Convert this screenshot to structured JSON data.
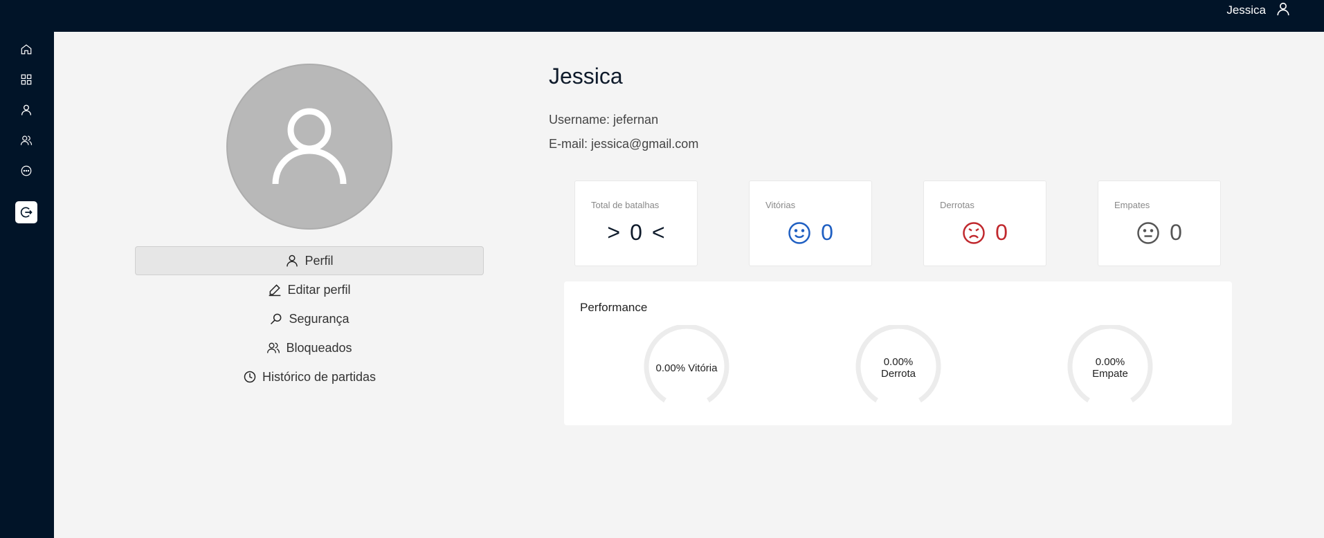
{
  "topbar": {
    "username": "Jessica",
    "user_icon": "user-icon"
  },
  "sidebar": {
    "items": [
      {
        "icon": "home-icon"
      },
      {
        "icon": "grid-icon"
      },
      {
        "icon": "user-icon"
      },
      {
        "icon": "users-icon"
      },
      {
        "icon": "chat-icon"
      }
    ],
    "logo_icon": "logout-icon"
  },
  "profile": {
    "name": "Jessica",
    "username_label": "Username: jefernan",
    "email_label": "E-mail: jessica@gmail.com"
  },
  "menu": {
    "items": [
      {
        "label": "Perfil",
        "icon": "user-icon",
        "active": true
      },
      {
        "label": "Editar perfil",
        "icon": "pencil-icon"
      },
      {
        "label": "Segurança",
        "icon": "search-icon"
      },
      {
        "label": "Bloqueados",
        "icon": "users-icon"
      },
      {
        "label": "Histórico de partidas",
        "icon": "clock-icon"
      }
    ]
  },
  "stats": [
    {
      "label": "Total de batalhas",
      "value": "0",
      "prefix": ">",
      "suffix": "<",
      "color": "#0f1b2b"
    },
    {
      "label": "Vitórias",
      "value": "0",
      "icon": "smile-icon",
      "color": "#1f5fc2"
    },
    {
      "label": "Derrotas",
      "value": "0",
      "icon": "frown-icon",
      "color": "#c0282d"
    },
    {
      "label": "Empates",
      "value": "0",
      "icon": "neutral-face-icon",
      "color": "#555555"
    }
  ],
  "performance": {
    "title": "Performance",
    "gauges": [
      {
        "label": "0.00% Vitória",
        "percent": 0
      },
      {
        "label": "0.00% Derrota",
        "percent": 0
      },
      {
        "label": "0.00% Empate",
        "percent": 0
      }
    ]
  }
}
